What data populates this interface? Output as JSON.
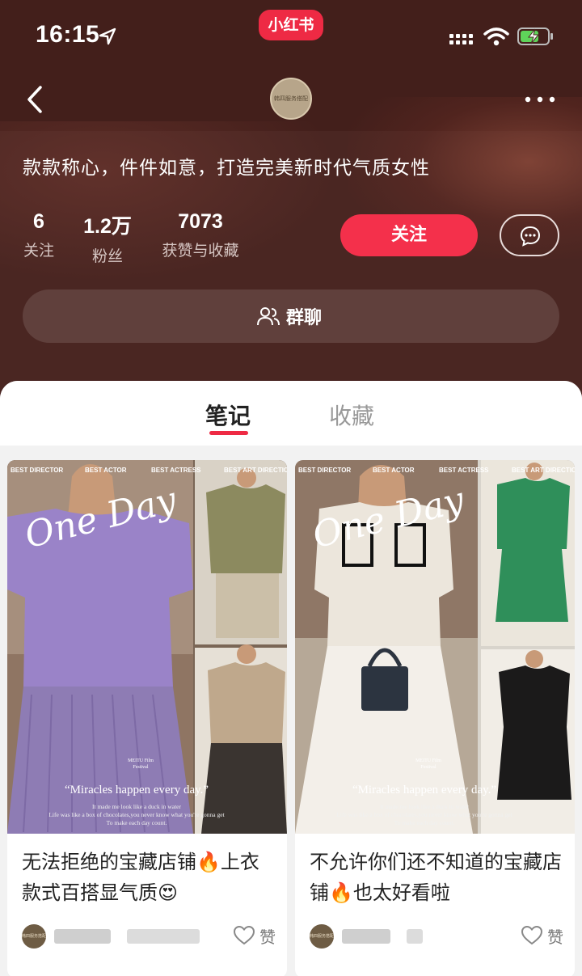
{
  "status_bar": {
    "time": "16:15",
    "app_badge": "小红书",
    "icons": [
      "location-arrow-icon",
      "signal-icon",
      "wifi-icon",
      "battery-charging-icon"
    ]
  },
  "profile": {
    "avatar_text": "韩四服务搭配",
    "bio": "款款称心，件件如意，打造完美新时代气质女性",
    "stats": [
      {
        "num": "6",
        "label": "关注"
      },
      {
        "num": "1.2万",
        "label": "粉丝"
      },
      {
        "num": "7073",
        "label": "获赞与收藏"
      }
    ],
    "follow_label": "关注",
    "group_label": "群聊"
  },
  "tabs": [
    {
      "label": "笔记",
      "active": true
    },
    {
      "label": "收藏",
      "active": false
    }
  ],
  "cards": [
    {
      "title": "无法拒绝的宝藏店铺🔥上衣款式百搭显气质😍",
      "like_label": "赞",
      "image": {
        "header": [
          "BEST DIRECTOR",
          "BEST ACTOR",
          "BEST ACTRESS",
          "BEST ART DIRECTION"
        ],
        "script": "One Day",
        "festival": "MEITU Film Festival",
        "quote": "“Miracles happen every day.”",
        "fine_print": [
          "It made me look like a duck in water",
          "Life was like a box of chocolates,you never know what you're gonna get",
          "To make each day count."
        ]
      }
    },
    {
      "title": "不允许你们还不知道的宝藏店铺🔥也太好看啦",
      "like_label": "赞",
      "image": {
        "header": [
          "BEST DIRECTOR",
          "BEST ACTOR",
          "BEST ACTRESS",
          "BEST ART DIRECTION"
        ],
        "script": "One Day",
        "festival": "MEITU Film Festival",
        "quote": "“Miracles happen every day.”",
        "fine_print": [
          "It made me look like a duck in water",
          "Life was like a box of chocolates,you never know what you're gonna get",
          "To make each day count."
        ]
      }
    }
  ],
  "colors": {
    "brand_red": "#ee2a44",
    "follow_red": "#f4304b",
    "header_bg": "#4a2622"
  }
}
